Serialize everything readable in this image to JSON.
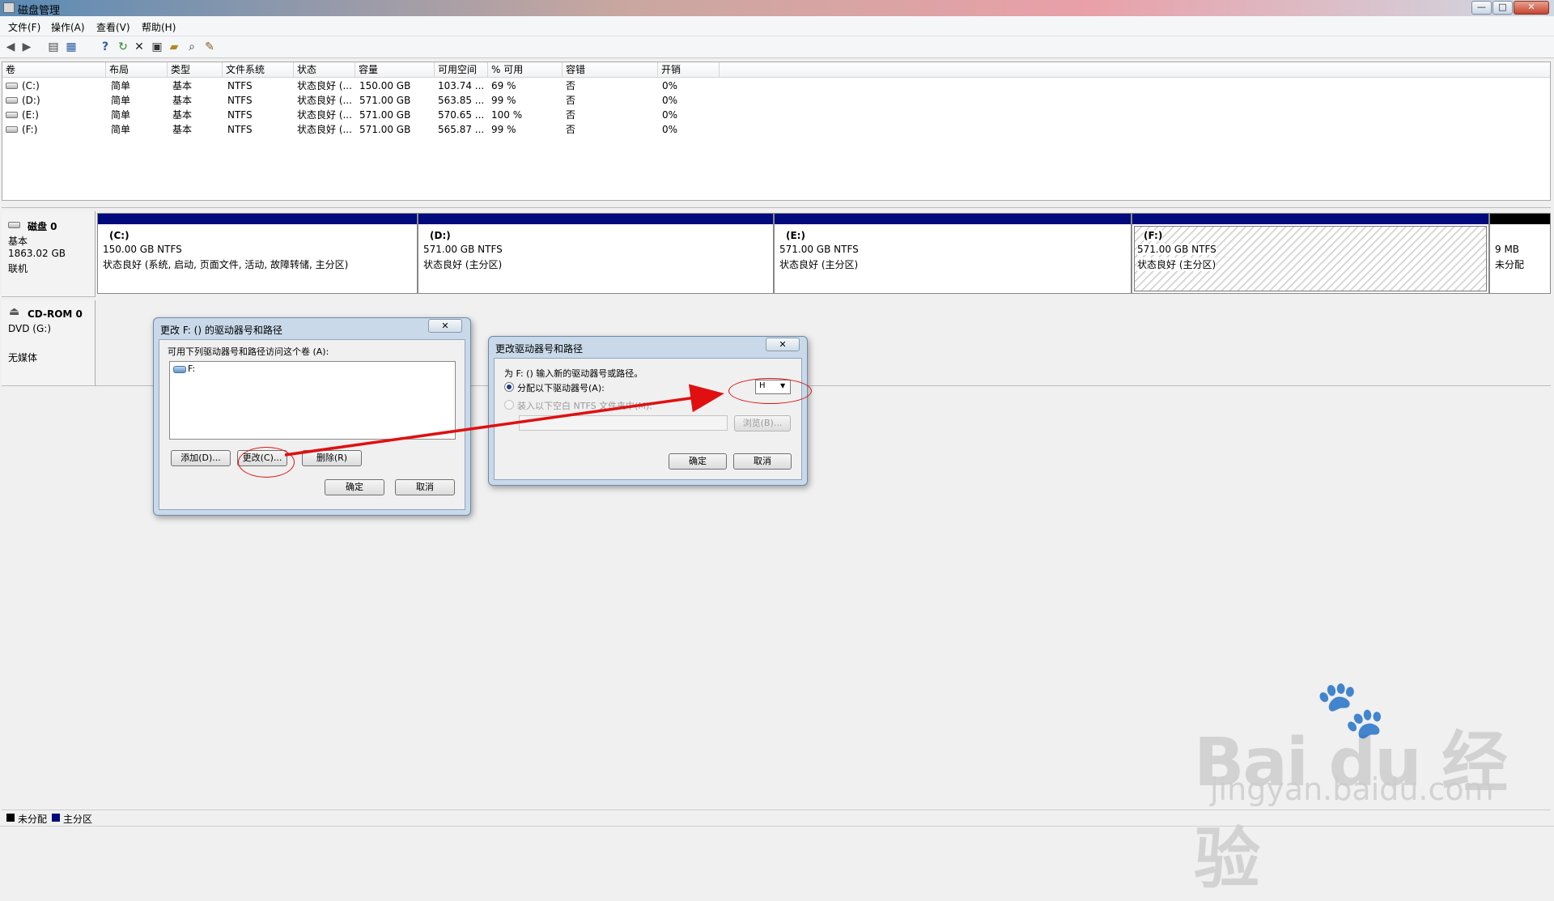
{
  "window": {
    "title": "磁盘管理",
    "buttons": [
      "—",
      "□",
      "✕"
    ]
  },
  "menu": [
    "文件(F)",
    "操作(A)",
    "查看(V)",
    "帮助(H)"
  ],
  "toolbar": [
    "back-icon",
    "forward-icon",
    "properties-list-icon",
    "view-icon",
    "help-icon",
    "refresh-icon",
    "delete-icon",
    "format-icon",
    "open-icon",
    "search-icon",
    "wizard-icon"
  ],
  "volume_list": {
    "columns": [
      "卷",
      "布局",
      "类型",
      "文件系统",
      "状态",
      "容量",
      "可用空间",
      "% 可用",
      "容错",
      "开销"
    ],
    "rows": [
      [
        "(C:)",
        "简单",
        "基本",
        "NTFS",
        "状态良好 (...",
        "150.00 GB",
        "103.74 ...",
        "69 %",
        "否",
        "0%"
      ],
      [
        "(D:)",
        "简单",
        "基本",
        "NTFS",
        "状态良好 (...",
        "571.00 GB",
        "563.85 ...",
        "99 %",
        "否",
        "0%"
      ],
      [
        "(E:)",
        "简单",
        "基本",
        "NTFS",
        "状态良好 (...",
        "571.00 GB",
        "570.65 ...",
        "100 %",
        "否",
        "0%"
      ],
      [
        "(F:)",
        "简单",
        "基本",
        "NTFS",
        "状态良好 (...",
        "571.00 GB",
        "565.87 ...",
        "99 %",
        "否",
        "0%"
      ]
    ]
  },
  "disk0": {
    "name": "磁盘 0",
    "type": "基本",
    "size": "1863.02 GB",
    "status": "联机",
    "partitions": [
      {
        "label": "(C:)",
        "size": "150.00 GB NTFS",
        "status": "状态良好 (系统, 启动, 页面文件, 活动, 故障转储, 主分区)"
      },
      {
        "label": "(D:)",
        "size": "571.00 GB NTFS",
        "status": "状态良好 (主分区)"
      },
      {
        "label": "(E:)",
        "size": "571.00 GB NTFS",
        "status": "状态良好 (主分区)"
      },
      {
        "label": "(F:)",
        "size": "571.00 GB NTFS",
        "status": "状态良好 (主分区)"
      },
      {
        "label": "",
        "size": "9 MB",
        "status": "未分配"
      }
    ]
  },
  "cdrom0": {
    "name": "CD-ROM 0",
    "type": "DVD (G:)",
    "status": "无媒体"
  },
  "legend": {
    "unallocated": "未分配",
    "primary": "主分区"
  },
  "dialog1": {
    "title": "更改 F: () 的驱动器号和路径",
    "close": "✕",
    "prompt": "可用下列驱动器号和路径访问这个卷 (A):",
    "list_item": "F:",
    "add": "添加(D)...",
    "change": "更改(C)...",
    "remove": "删除(R)",
    "ok": "确定",
    "cancel": "取消"
  },
  "dialog2": {
    "title": "更改驱动器号和路径",
    "close": "✕",
    "prompt": "为 F: () 输入新的驱动器号或路径。",
    "opt_assign": "分配以下驱动器号(A):",
    "selected_letter": "H",
    "opt_mount": "装入以下空白 NTFS 文件夹中(M):",
    "browse": "浏览(B)...",
    "ok": "确定",
    "cancel": "取消"
  },
  "colors": {
    "primary_partition": "#000a7c",
    "unallocated": "#000000",
    "annotation": "#e01010"
  },
  "watermark": {
    "big": "Bai du 经验",
    "small": "jingyan.baidu.com"
  }
}
